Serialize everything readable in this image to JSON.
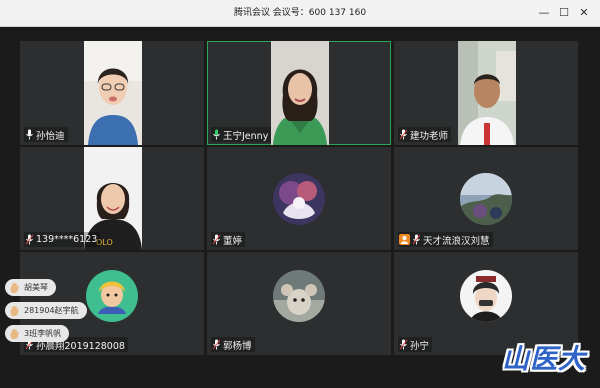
{
  "window": {
    "title": "腾讯会议 会议号：600 137 160",
    "minimize": "—",
    "maximize": "☐",
    "close": "✕"
  },
  "participants": [
    {
      "name": "孙怡迪",
      "mic": "on",
      "view": "video"
    },
    {
      "name": "王宁Jenny",
      "mic": "on",
      "view": "video",
      "active_speaker": true
    },
    {
      "name": "建功老师",
      "mic": "off",
      "view": "video"
    },
    {
      "name": "139****6123",
      "mic": "off",
      "view": "video"
    },
    {
      "name": "董婷",
      "mic": "off",
      "view": "avatar"
    },
    {
      "name": "天才流浪汉刘慧",
      "mic": "off",
      "view": "avatar",
      "host_badge": true
    },
    {
      "name": "孙晨翔2019128008",
      "mic": "off",
      "view": "avatar"
    },
    {
      "name": "郭杨博",
      "mic": "off",
      "view": "avatar"
    },
    {
      "name": "孙宁",
      "mic": "off",
      "view": "avatar"
    }
  ],
  "raised_hands": [
    {
      "name": "胡美琴"
    },
    {
      "name": "281904赵宇航"
    },
    {
      "name": "3班李帆帆"
    }
  ],
  "watermark": "山医大",
  "colors": {
    "active_border": "#2fa35a",
    "watermark": "#2f63c8"
  }
}
